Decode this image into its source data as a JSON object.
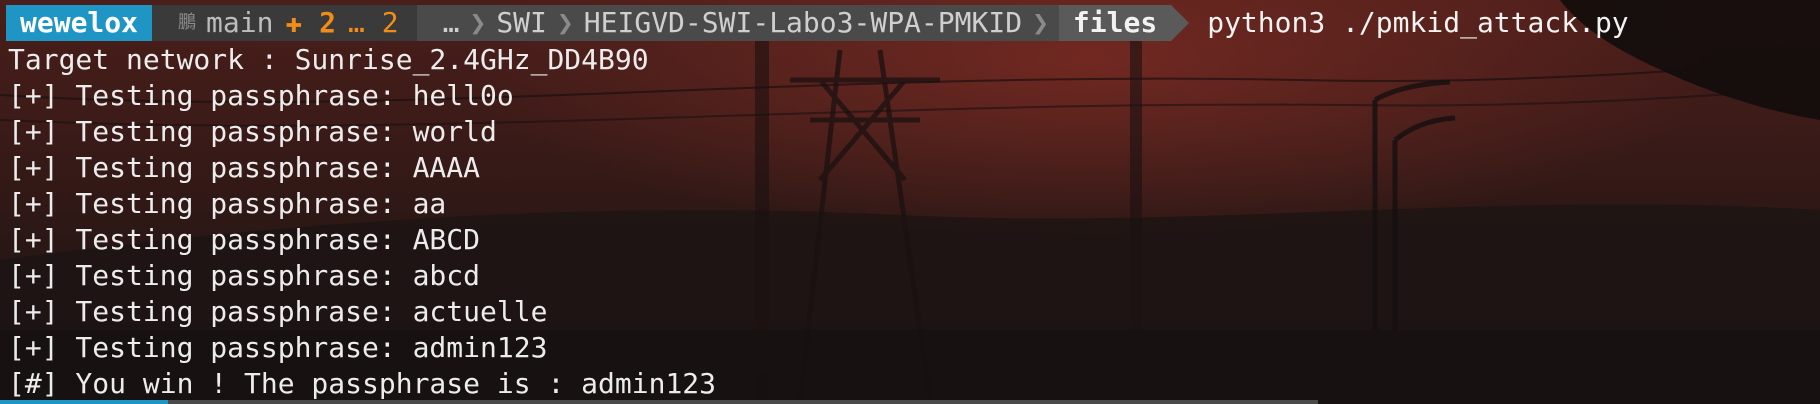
{
  "prompt": {
    "user": "wewelox",
    "git_icon": "branch-icon",
    "branch": "main",
    "staged": "✚ 2",
    "untracked": "… 2",
    "path": [
      "…",
      "SWI",
      "HEIGVD-SWI-Labo3-WPA-PMKID"
    ],
    "current_dir": "files",
    "command": "python3 ./pmkid_attack.py"
  },
  "output": [
    "Target network : Sunrise_2.4GHz_DD4B90",
    "[+] Testing passphrase: hell0o",
    "[+] Testing passphrase: world",
    "[+] Testing passphrase: AAAA",
    "[+] Testing passphrase: aa",
    "[+] Testing passphrase: ABCD",
    "[+] Testing passphrase: abcd",
    "[+] Testing passphrase: actuelle",
    "[+] Testing passphrase: admin123",
    "[#] You win ! The passphrase is : admin123"
  ],
  "colors": {
    "user_bg": "#1e95c4",
    "git_bg": "#3a3a3a",
    "path_bg": "#4a4a4a",
    "dir_bg": "#5a5a5a",
    "dirty": "#f28c18",
    "text": "#ececec"
  }
}
